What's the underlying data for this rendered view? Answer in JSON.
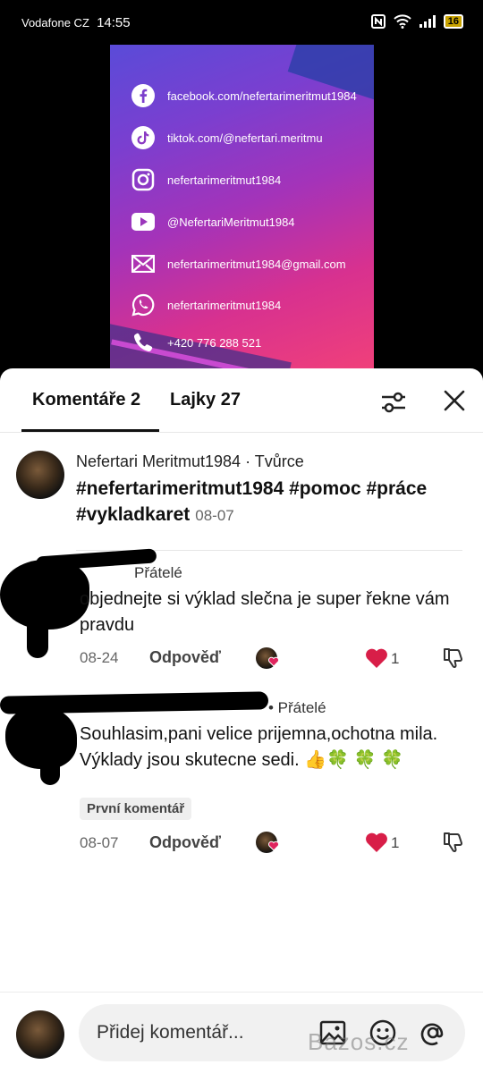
{
  "status_bar": {
    "carrier": "Vodafone CZ",
    "time": "14:55",
    "battery": "16"
  },
  "video": {
    "social_links": [
      {
        "icon": "facebook-icon",
        "text": "facebook.com/nefertarimeritmut1984"
      },
      {
        "icon": "tiktok-icon",
        "text": "tiktok.com/@nefertari.meritmu"
      },
      {
        "icon": "instagram-icon",
        "text": "nefertarimeritmut1984"
      },
      {
        "icon": "youtube-icon",
        "text": "@NefertariMeritmut1984"
      },
      {
        "icon": "mail-icon",
        "text": "nefertarimeritmut1984@gmail.com"
      },
      {
        "icon": "whatsapp-icon",
        "text": "nefertarimeritmut1984"
      },
      {
        "icon": "phone-icon",
        "text": "+420 776 288 521"
      }
    ]
  },
  "tabs": {
    "comments": "Komentáře 2",
    "likes": "Lajky 27"
  },
  "creator_comment": {
    "author": "Nefertari Meritmut1984 · Tvůrce",
    "text": "#nefertarimeritmut1984 #pomoc #práce #vykladkaret",
    "date": "08-07"
  },
  "comments": [
    {
      "relation": "Přátelé",
      "text": "objednejte si výklad slečna je super řekne vám pravdu",
      "date": "08-24",
      "reply_label": "Odpověď",
      "likes": "1"
    },
    {
      "relation": "• Přátelé",
      "text": "Souhlasim,pani velice prijemna,ochotna mila. Výklady jsou skutecne sedi. 👍🍀 🍀 🍀",
      "badge": "První komentář",
      "date": "08-07",
      "reply_label": "Odpověď",
      "likes": "1"
    }
  ],
  "input": {
    "placeholder": "Přidej komentář..."
  },
  "watermark": "Bazos.cz",
  "colors": {
    "heart": "#e0245e",
    "poster_start": "#5a4bd8",
    "poster_end": "#f0407a"
  }
}
